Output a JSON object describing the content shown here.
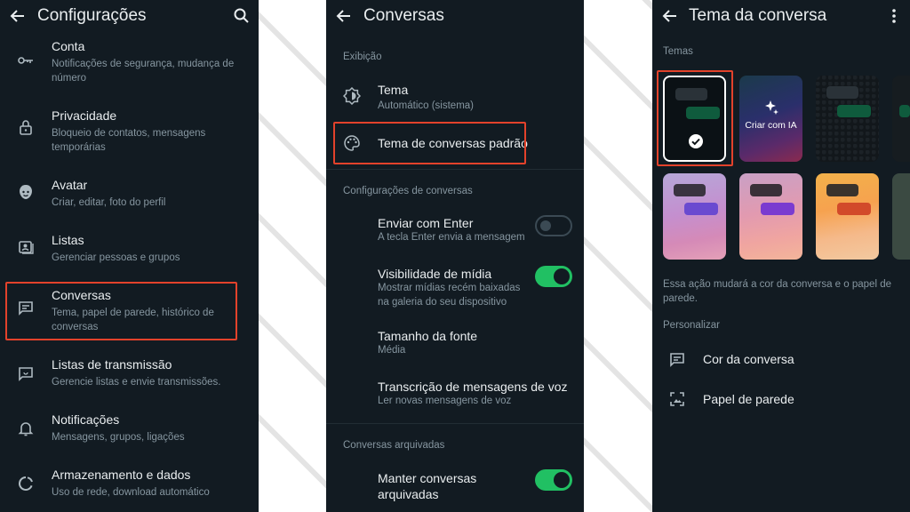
{
  "settings": {
    "title": "Configurações",
    "items": [
      {
        "label": "Conta",
        "desc": "Notificações de segurança, mudança de número"
      },
      {
        "label": "Privacidade",
        "desc": "Bloqueio de contatos, mensagens temporárias"
      },
      {
        "label": "Avatar",
        "desc": "Criar, editar, foto do perfil"
      },
      {
        "label": "Listas",
        "desc": "Gerenciar pessoas e grupos"
      },
      {
        "label": "Conversas",
        "desc": "Tema, papel de parede, histórico de conversas"
      },
      {
        "label": "Listas de transmissão",
        "desc": "Gerencie listas e envie transmissões."
      },
      {
        "label": "Notificações",
        "desc": "Mensagens, grupos, ligações"
      },
      {
        "label": "Armazenamento e dados",
        "desc": "Uso de rede, download automático"
      }
    ]
  },
  "chats": {
    "title": "Conversas",
    "display_section": "Exibição",
    "theme_label": "Tema",
    "theme_value": "Automático (sistema)",
    "default_theme_label": "Tema de conversas padrão",
    "chat_settings_section": "Configurações de conversas",
    "enter_label": "Enviar com Enter",
    "enter_desc": "A tecla Enter envia a mensagem",
    "media_label": "Visibilidade de mídia",
    "media_desc": "Mostrar mídias recém baixadas na galeria do seu dispositivo",
    "font_label": "Tamanho da fonte",
    "font_value": "Média",
    "transcription_label": "Transcrição de mensagens de voz",
    "transcription_desc": "Ler novas mensagens de voz",
    "archived_section": "Conversas arquivadas",
    "keep_archived_label": "Manter conversas arquivadas",
    "enter_toggle": "off",
    "media_toggle": "on",
    "keep_archived_toggle": "on"
  },
  "theme": {
    "title": "Tema da conversa",
    "themes_section": "Temas",
    "create_ai_label": "Criar com IA",
    "note": "Essa ação mudará a cor da conversa e o papel de parede.",
    "personalize_section": "Personalizar",
    "chat_color_label": "Cor da conversa",
    "wallpaper_label": "Papel de parede"
  },
  "colors": {
    "panel_bg": "#121b22",
    "accent_green": "#21c063",
    "highlight_red": "#e3422b",
    "text_primary": "#e9edef",
    "text_secondary": "#8696a0"
  }
}
